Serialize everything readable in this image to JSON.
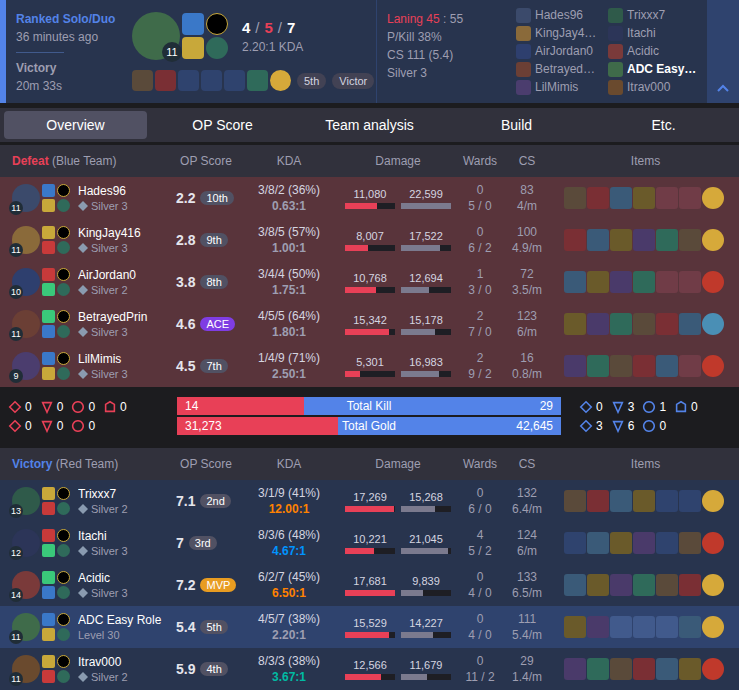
{
  "header": {
    "queue": "Ranked Solo/Duo",
    "time_ago": "36 minutes ago",
    "result": "Victory",
    "duration": "20m 33s",
    "champion_level": "11",
    "kills": "4",
    "deaths": "5",
    "assists": "7",
    "separator": "/",
    "kda": "2.20:1 KDA",
    "items": [
      {
        "filled": true
      },
      {
        "filled": true
      },
      {
        "filled": false
      },
      {
        "filled": false
      },
      {
        "filled": false
      },
      {
        "filled": true
      }
    ],
    "trinket_color": "#d6a93a",
    "badges": [
      "5th",
      "Victor"
    ],
    "laning_label": "Laning 45",
    "laning_value": ": 55",
    "stats": [
      "P/Kill 38%",
      "CS 111 (5.4)",
      "Silver 3"
    ],
    "participants": {
      "left": [
        {
          "name": "Hades96",
          "selected": false
        },
        {
          "name": "KingJay4…",
          "selected": false
        },
        {
          "name": "AirJordan0",
          "selected": false
        },
        {
          "name": "Betrayed…",
          "selected": false
        },
        {
          "name": "LilMimis",
          "selected": false
        }
      ],
      "right": [
        {
          "name": "Trixxx7",
          "selected": false
        },
        {
          "name": "Itachi",
          "selected": false
        },
        {
          "name": "Acidic",
          "selected": false
        },
        {
          "name": "ADC Easy…",
          "selected": true
        },
        {
          "name": "Itrav000",
          "selected": false
        }
      ]
    }
  },
  "tabs": [
    {
      "label": "Overview",
      "selected": true
    },
    {
      "label": "OP Score",
      "selected": false
    },
    {
      "label": "Team analysis",
      "selected": false
    },
    {
      "label": "Build",
      "selected": false
    },
    {
      "label": "Etc.",
      "selected": false
    }
  ],
  "columns": [
    "OP Score",
    "KDA",
    "Damage",
    "Wards",
    "CS",
    "Items"
  ],
  "teams": [
    {
      "result": "Defeat",
      "side": "(Blue Team)",
      "color": "#e84057",
      "won": false,
      "players": [
        {
          "name": "Hades96",
          "rank": "Silver 3",
          "emblem": true,
          "level": "11",
          "op_score": "2.2",
          "badge": "10th",
          "badge_color": "#515163",
          "kda": "3/8/2 (36%)",
          "ratio": "0.63:1",
          "ratio_color": "#9e9eb1",
          "dealt": "11,080",
          "dealt_level": 0.63,
          "taken": "22,599",
          "taken_level": 1.0,
          "wards": "0",
          "wards_detail": "5 / 0",
          "cs": "83",
          "cs_per_min": "4/m",
          "items": [
            true,
            true,
            true,
            true,
            false,
            false
          ],
          "trinket_color": "#d6a93a",
          "selected": false
        },
        {
          "name": "KingJay416",
          "rank": "Silver 3",
          "emblem": true,
          "level": "11",
          "op_score": "2.8",
          "badge": "9th",
          "badge_color": "#515163",
          "kda": "3/8/5 (57%)",
          "ratio": "1.00:1",
          "ratio_color": "#9e9eb1",
          "dealt": "8,007",
          "dealt_level": 0.45,
          "taken": "17,522",
          "taken_level": 0.78,
          "wards": "0",
          "wards_detail": "6 / 2",
          "cs": "100",
          "cs_per_min": "4.9/m",
          "items": [
            true,
            true,
            true,
            true,
            true,
            true
          ],
          "trinket_color": "#d6a93a",
          "selected": false
        },
        {
          "name": "AirJordan0",
          "rank": "Silver 2",
          "emblem": true,
          "level": "10",
          "op_score": "3.8",
          "badge": "8th",
          "badge_color": "#515163",
          "kda": "3/4/4 (50%)",
          "ratio": "1.75:1",
          "ratio_color": "#9e9eb1",
          "dealt": "10,768",
          "dealt_level": 0.61,
          "taken": "12,694",
          "taken_level": 0.56,
          "wards": "1",
          "wards_detail": "3 / 0",
          "cs": "72",
          "cs_per_min": "3.5/m",
          "items": [
            true,
            true,
            true,
            true,
            false,
            false
          ],
          "trinket_color": "#c0392b",
          "selected": false
        },
        {
          "name": "BetrayedPrin",
          "rank": "Silver 3",
          "emblem": true,
          "level": "11",
          "op_score": "4.6",
          "badge": "ACE",
          "badge_color": "#7f3de3",
          "kda": "4/5/5 (64%)",
          "ratio": "1.80:1",
          "ratio_color": "#9e9eb1",
          "dealt": "15,342",
          "dealt_level": 0.87,
          "taken": "15,178",
          "taken_level": 0.67,
          "wards": "2",
          "wards_detail": "7 / 0",
          "cs": "123",
          "cs_per_min": "6/m",
          "items": [
            true,
            true,
            true,
            true,
            true,
            true
          ],
          "trinket_color": "#4a8fb5",
          "selected": false
        },
        {
          "name": "LilMimis",
          "rank": "Silver 3",
          "emblem": true,
          "level": "9",
          "op_score": "4.5",
          "badge": "7th",
          "badge_color": "#515163",
          "kda": "1/4/9 (71%)",
          "ratio": "2.50:1",
          "ratio_color": "#9e9eb1",
          "dealt": "5,301",
          "dealt_level": 0.3,
          "taken": "16,983",
          "taken_level": 0.75,
          "wards": "2",
          "wards_detail": "9 / 2",
          "cs": "16",
          "cs_per_min": "0.8/m",
          "items": [
            true,
            true,
            true,
            true,
            true,
            false
          ],
          "trinket_color": "#c0392b",
          "selected": false
        }
      ]
    },
    {
      "result": "Victory",
      "side": "(Red Team)",
      "color": "#5383e8",
      "won": true,
      "players": [
        {
          "name": "Trixxx7",
          "rank": "Silver 2",
          "emblem": true,
          "level": "13",
          "op_score": "7.1",
          "badge": "2nd",
          "badge_color": "#515163",
          "kda": "3/1/9 (41%)",
          "ratio": "12.00:1",
          "ratio_color": "#ff8200",
          "dealt": "17,269",
          "dealt_level": 0.98,
          "taken": "15,268",
          "taken_level": 0.68,
          "wards": "0",
          "wards_detail": "6 / 0",
          "cs": "132",
          "cs_per_min": "6.4/m",
          "items": [
            true,
            true,
            true,
            true,
            false,
            false
          ],
          "trinket_color": "#d6a93a",
          "selected": false
        },
        {
          "name": "Itachi",
          "rank": "Silver 3",
          "emblem": true,
          "level": "12",
          "op_score": "7",
          "badge": "3rd",
          "badge_color": "#515163",
          "kda": "8/3/6 (48%)",
          "ratio": "4.67:1",
          "ratio_color": "#0093ff",
          "dealt": "10,221",
          "dealt_level": 0.58,
          "taken": "21,045",
          "taken_level": 0.93,
          "wards": "4",
          "wards_detail": "5 / 2",
          "cs": "124",
          "cs_per_min": "6/m",
          "items": [
            false,
            true,
            true,
            true,
            false,
            true
          ],
          "trinket_color": "#c0392b",
          "selected": false
        },
        {
          "name": "Acidic",
          "rank": "Silver 3",
          "emblem": true,
          "level": "14",
          "op_score": "7.2",
          "badge": "MVP",
          "badge_color": "#e89c21",
          "kda": "6/2/7 (45%)",
          "ratio": "6.50:1",
          "ratio_color": "#ff8200",
          "dealt": "17,681",
          "dealt_level": 1.0,
          "taken": "9,839",
          "taken_level": 0.44,
          "wards": "0",
          "wards_detail": "4 / 0",
          "cs": "133",
          "cs_per_min": "6.5/m",
          "items": [
            true,
            true,
            true,
            true,
            true,
            true
          ],
          "trinket_color": "#d6a93a",
          "selected": false
        },
        {
          "name": "ADC Easy Role",
          "rank": "Level 30",
          "emblem": false,
          "level": "11",
          "op_score": "5.4",
          "badge": "5th",
          "badge_color": "#515163",
          "kda": "4/5/7 (38%)",
          "ratio": "2.20:1",
          "ratio_color": "#9e9eb1",
          "dealt": "15,529",
          "dealt_level": 0.88,
          "taken": "14,227",
          "taken_level": 0.63,
          "wards": "0",
          "wards_detail": "4 / 0",
          "cs": "111",
          "cs_per_min": "5.4/m",
          "items": [
            true,
            true,
            false,
            false,
            false,
            true
          ],
          "trinket_color": "#d6a93a",
          "selected": true
        },
        {
          "name": "Itrav000",
          "rank": "Silver 2",
          "emblem": true,
          "level": "11",
          "op_score": "5.9",
          "badge": "4th",
          "badge_color": "#515163",
          "kda": "8/3/3 (38%)",
          "ratio": "3.67:1",
          "ratio_color": "#00bba3",
          "dealt": "12,566",
          "dealt_level": 0.71,
          "taken": "11,679",
          "taken_level": 0.52,
          "wards": "0",
          "wards_detail": "11 / 2",
          "cs": "29",
          "cs_per_min": "1.4/m",
          "items": [
            true,
            true,
            true,
            true,
            true,
            true
          ],
          "trinket_color": "#c0392b",
          "selected": false
        }
      ]
    }
  ],
  "summary": {
    "left_objectives": {
      "top": [
        "0",
        "0",
        "0",
        "0"
      ],
      "bottom": [
        "0",
        "0",
        "0"
      ]
    },
    "right_objectives": {
      "top": [
        "0",
        "3",
        "1",
        "0"
      ],
      "bottom": [
        "3",
        "6",
        "0"
      ]
    },
    "bars": [
      {
        "label": "Total Kill",
        "left": "14",
        "right": "29",
        "level": 0.33
      },
      {
        "label": "Total Gold",
        "left": "31,273",
        "right": "42,645",
        "level": 0.42
      }
    ]
  }
}
